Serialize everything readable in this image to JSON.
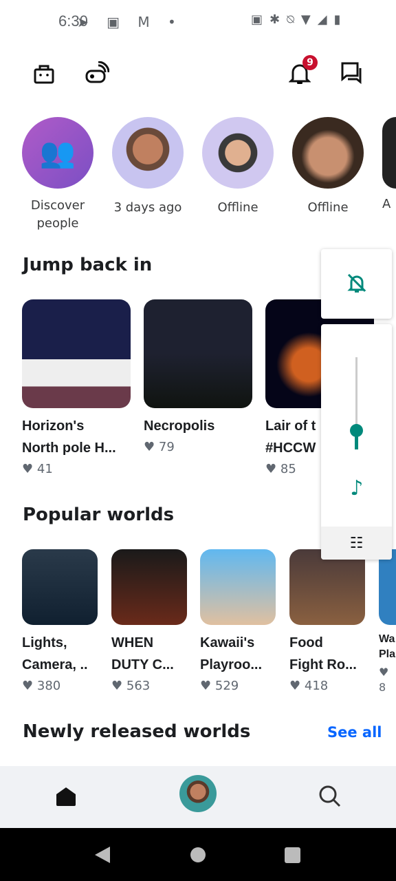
{
  "status_bar": {
    "time": "6:30",
    "notification_icons": [
      "telegram-icon",
      "teams-icon",
      "gmail-icon",
      "dot-icon"
    ],
    "system_icons": [
      "nfc-icon",
      "bluetooth-icon",
      "bell-off-icon",
      "wifi-icon",
      "signal-icon",
      "battery-icon"
    ]
  },
  "header": {
    "notification_count": "9"
  },
  "friends": [
    {
      "label": "Discover people"
    },
    {
      "label": "3 days ago"
    },
    {
      "label": "Offline"
    },
    {
      "label": "Offline"
    },
    {
      "label": "A"
    }
  ],
  "jump_back_in": {
    "title": "Jump back in",
    "items": [
      {
        "title_line1": "Horizon's",
        "title_line2": "North pole H...",
        "likes": "41"
      },
      {
        "title_line1": "Necropolis",
        "title_line2": "",
        "likes": "79"
      },
      {
        "title_line1": "Lair of t",
        "title_line2": "#HCCW",
        "likes": "85"
      }
    ]
  },
  "popular": {
    "title": "Popular worlds",
    "items": [
      {
        "title_line1": "Lights,",
        "title_line2": "Camera, ..",
        "likes": "380"
      },
      {
        "title_line1": "WHEN",
        "title_line2": "DUTY C...",
        "likes": "563"
      },
      {
        "title_line1": "Kawaii's",
        "title_line2": "Playroo...",
        "likes": "529"
      },
      {
        "title_line1": "Food",
        "title_line2": "Fight Ro...",
        "likes": "418"
      },
      {
        "title_line1": "Wa",
        "title_line2": "Pla",
        "likes": "8"
      }
    ]
  },
  "newly": {
    "title": "Newly released worlds",
    "see_all": "See all"
  },
  "volume_panel": {
    "level_percent": 20,
    "accent": "#00897b"
  },
  "colors": {
    "link": "#0866ff",
    "badge": "#c8102e"
  }
}
